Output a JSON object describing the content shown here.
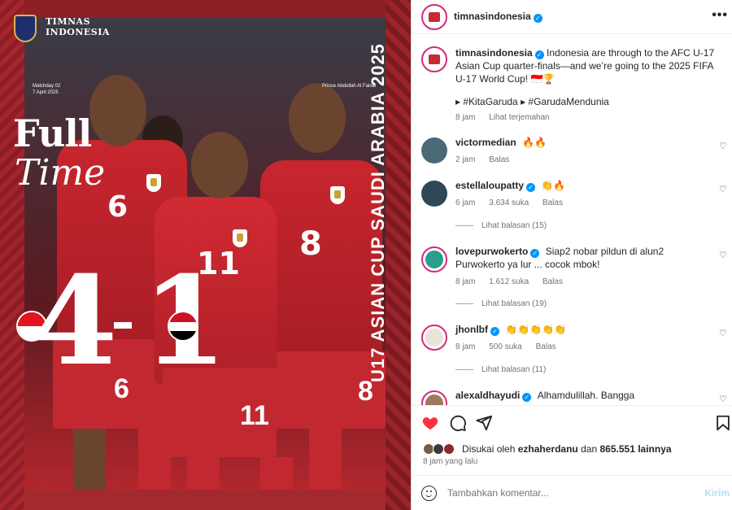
{
  "post_image": {
    "brand": "TIMNAS INDONESIA",
    "matchday": "Matchday 02",
    "date": "7 April 2025",
    "player_caption": "Prince Abdullah Al Faisal",
    "headline_1": "Full",
    "headline_2": "Time",
    "tournament_vertical": "U17 ASIAN CUP SAUDI ARABIA 2025",
    "score_home": "4",
    "score_away": "1",
    "jersey_numbers": [
      "6",
      "11",
      "8",
      "6",
      "11",
      "8"
    ]
  },
  "header": {
    "username": "timnasindonesia",
    "more_label": "•••"
  },
  "caption": {
    "username": "timnasindonesia",
    "text": "Indonesia are through to the AFC U-17 Asian Cup quarter-finals—and we’re going to the 2025 FIFA U-17 World Cup! 🇮🇩🏆",
    "hashtags": "▸ #KitaGaruda ▸ #GarudaMendunia",
    "time": "8 jam",
    "translate": "Lihat terjemahan"
  },
  "comments": [
    {
      "username": "victormedian",
      "verified": false,
      "text": "🔥🔥",
      "time": "2 jam",
      "likes": "",
      "reply": "Balas",
      "replies": ""
    },
    {
      "username": "estellaloupatty",
      "verified": true,
      "text": "👏🔥",
      "time": "6 jam",
      "likes": "3.634 suka",
      "reply": "Balas",
      "replies": "Lihat balasan (15)"
    },
    {
      "username": "lovepurwokerto",
      "verified": true,
      "text": "Siap2 nobar pildun di alun2 Purwokerto ya lur ... cocok mbok!",
      "time": "8 jam",
      "likes": "1.612 suka",
      "reply": "Balas",
      "replies": "Lihat balasan (19)"
    },
    {
      "username": "jhonlbf",
      "verified": true,
      "text": "👏👏👏👏👏",
      "time": "8 jam",
      "likes": "500 suka",
      "reply": "Balas",
      "replies": "Lihat balasan (11)"
    },
    {
      "username": "alexaldhayudi",
      "verified": true,
      "text": "Alhamdulillah. Bangga",
      "time": "",
      "likes": "",
      "reply": "",
      "replies": ""
    }
  ],
  "actions": {
    "liked_by_prefix": "Disukai oleh",
    "liked_by_user": "ezhaherdanu",
    "liked_by_mid": "dan",
    "liked_by_count": "865.551 lainnya",
    "posted_ago": "8 jam yang lalu"
  },
  "composer": {
    "placeholder": "Tambahkan komentar...",
    "send_label": "Kirim"
  },
  "colors": {
    "verified": "#0095f6",
    "like_red": "#ff3040",
    "hashtag": "#00376b",
    "send_disabled": "#b2dffc",
    "jersey_red": "#c8262e"
  }
}
